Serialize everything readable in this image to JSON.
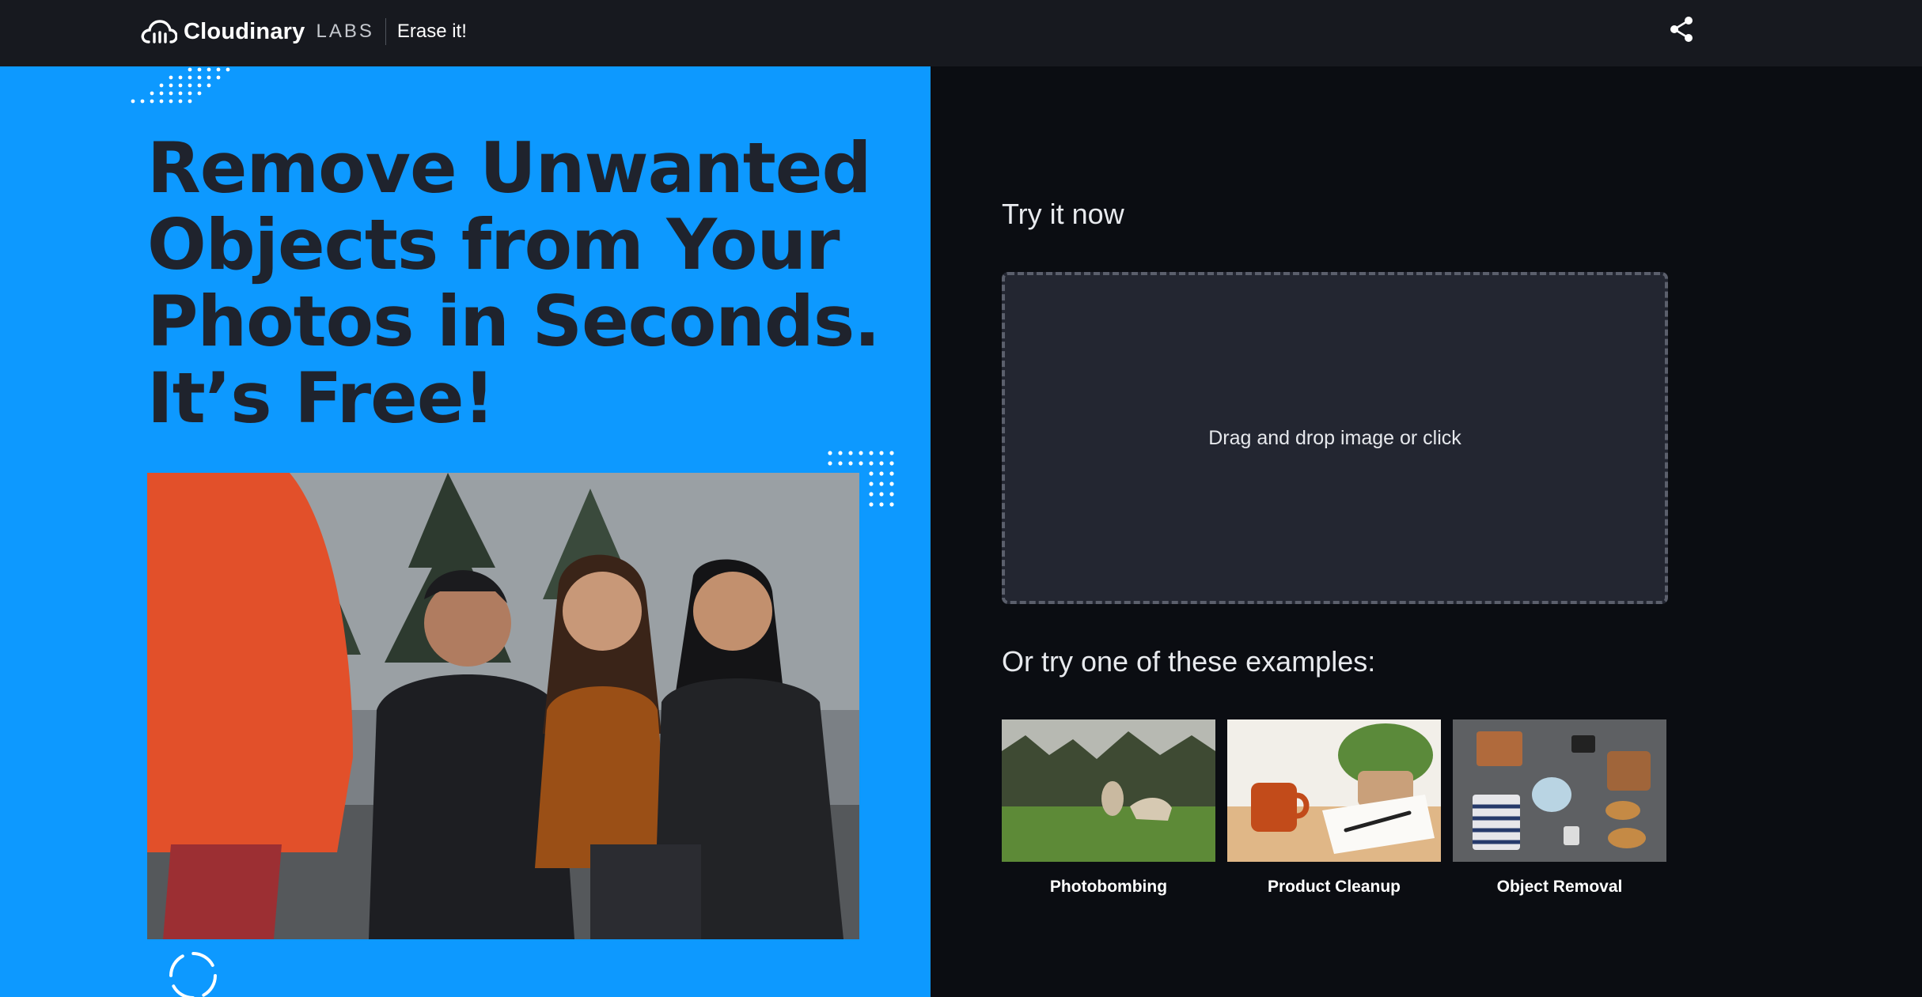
{
  "header": {
    "brand": "Cloudinary",
    "labs": "LABS",
    "product": "Erase it!",
    "share_icon": "share-icon"
  },
  "hero": {
    "headline_lines": [
      "Remove Unwanted",
      "Objects from Your",
      "Photos in Seconds.",
      "It’s Free!"
    ]
  },
  "upload": {
    "try_label": "Try it now",
    "drop_label": "Drag and drop image or click"
  },
  "examples": {
    "title": "Or try one of these examples:",
    "items": [
      {
        "label": "Photobombing"
      },
      {
        "label": "Product Cleanup"
      },
      {
        "label": "Object Removal"
      }
    ]
  },
  "colors": {
    "accent_blue": "#0d99ff",
    "header_bg": "#17191f",
    "page_bg": "#0b0d12",
    "dropzone_bg": "#232631",
    "headline_text": "#1f232d"
  }
}
